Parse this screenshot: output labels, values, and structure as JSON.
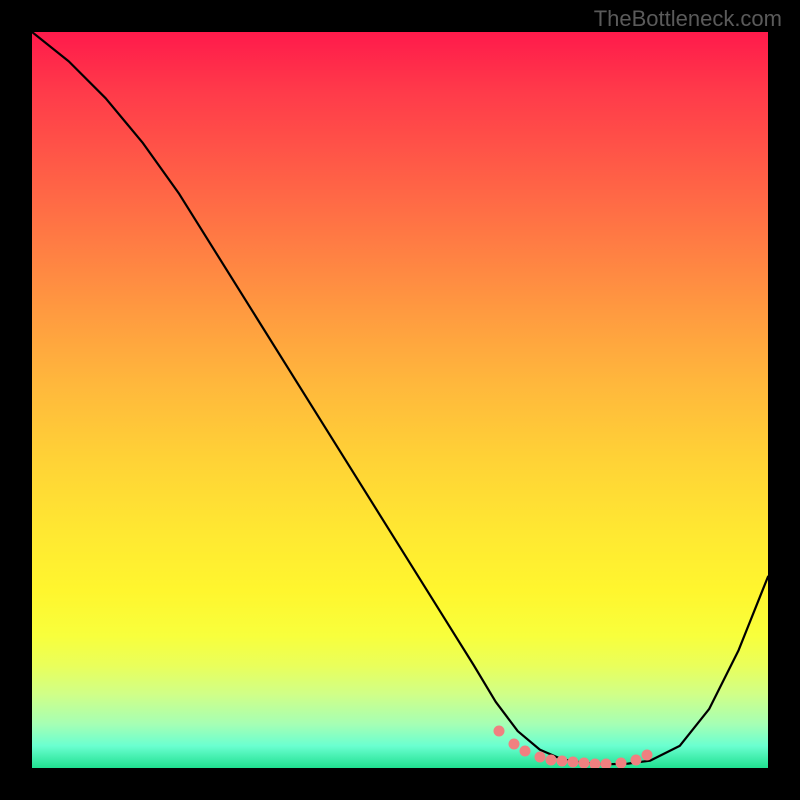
{
  "watermark": "TheBottleneck.com",
  "chart_data": {
    "type": "line",
    "title": "",
    "xlabel": "",
    "ylabel": "",
    "xlim": [
      0,
      100
    ],
    "ylim": [
      0,
      100
    ],
    "grid": false,
    "series": [
      {
        "name": "curve",
        "x": [
          0,
          5,
          10,
          15,
          20,
          25,
          30,
          35,
          40,
          45,
          50,
          55,
          60,
          63,
          66,
          69,
          72,
          75,
          78,
          81,
          84,
          88,
          92,
          96,
          100
        ],
        "values": [
          100,
          96,
          91,
          85,
          78,
          70,
          62,
          54,
          46,
          38,
          30,
          22,
          14,
          9,
          5,
          2.5,
          1.2,
          0.7,
          0.5,
          0.6,
          1.0,
          3.0,
          8.0,
          16,
          26
        ]
      }
    ],
    "marker_points": {
      "name": "highlight-dots",
      "x": [
        63.5,
        65.5,
        67,
        69,
        70.5,
        72,
        73.5,
        75,
        76.5,
        78,
        80,
        82,
        83.5
      ],
      "values": [
        5.0,
        3.3,
        2.3,
        1.5,
        1.1,
        0.9,
        0.75,
        0.65,
        0.6,
        0.6,
        0.7,
        1.1,
        1.7
      ]
    }
  }
}
